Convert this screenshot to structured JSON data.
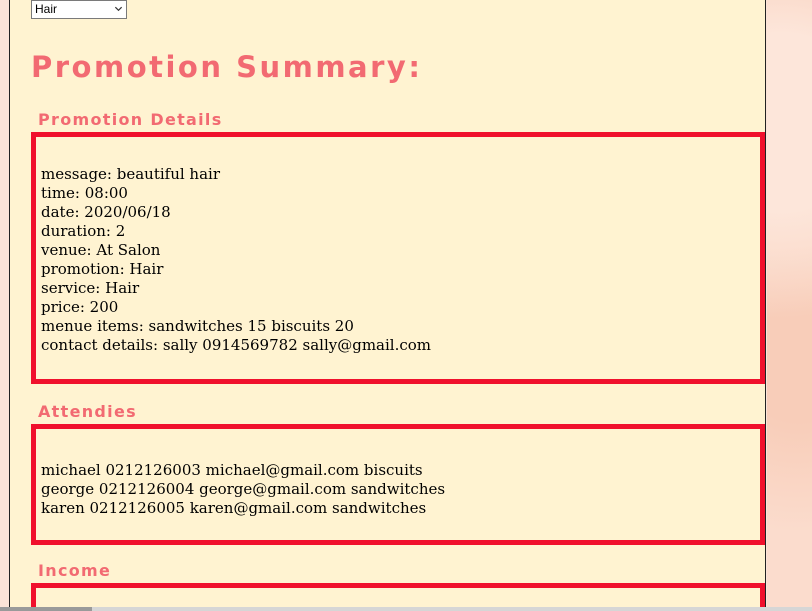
{
  "filter_select": {
    "selected": "Hair",
    "icon": "chevron-down-icon"
  },
  "page_title": "Promotion Summary:",
  "promotion_details": {
    "heading": "Promotion Details",
    "lines": [
      "message: beautiful hair",
      "time: 08:00",
      "date: 2020/06/18",
      "duration: 2",
      "venue: At Salon",
      "promotion: Hair",
      "service: Hair",
      "price: 200",
      "menue items: sandwitches 15 biscuits 20",
      "contact details: sally 0914569782 sally@gmail.com"
    ]
  },
  "attendees": {
    "heading": "Attendies",
    "lines": [
      "michael 0212126003 michael@gmail.com biscuits",
      "george 0212126004 george@gmail.com sandwitches",
      "karen 0212126005 karen@gmail.com sandwitches"
    ]
  },
  "income": {
    "heading": "Income"
  },
  "colors": {
    "accent": "#f26a72",
    "box_border": "#f0102c",
    "panel_bg": "#fff3d1"
  }
}
